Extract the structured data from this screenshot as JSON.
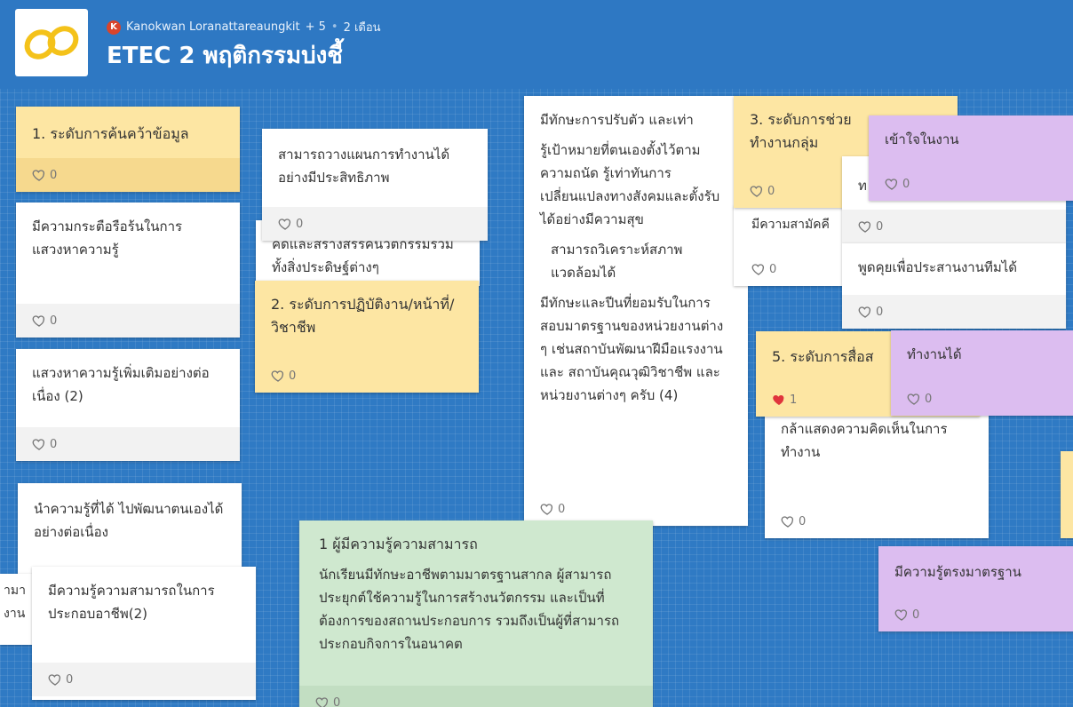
{
  "header": {
    "avatar_initial": "K",
    "author": "Kanokwan Loranattareaungkit",
    "contributors": "+ 5",
    "separator": "•",
    "time_ago": "2 เดือน",
    "title": "ETEC 2 พฤติกรรมบ่งชี้"
  },
  "colors": {
    "background": "#2f7ac4",
    "yellow_card": "#fde6a3",
    "green_card": "#cfe8cf",
    "purple_card": "#dcbdf0",
    "heart_liked": "#e0343c"
  },
  "posts": {
    "level1": {
      "text": "1. ระดับการค้นคว้าข้อมูล",
      "likes": "0"
    },
    "eager": {
      "text": "มีความกระตือรือร้นในการแสวงหาความรู้",
      "likes": "0"
    },
    "seek": {
      "text": "แสวงหาความรู้เพิ่มเติมอย่างต่อเนื่อง (2)",
      "likes": "0"
    },
    "apply_knowledge": {
      "text": "นำความรู้ที่ได้ ไปพัฒนาตนเองได้อย่างต่อเนื่อง"
    },
    "partial_left": {
      "line1": "ามา",
      "line2": "งาน"
    },
    "occupation": {
      "text": "มีความรู้ความสามารถในการประกอบอาชีพ(2)",
      "likes": "0"
    },
    "plan": {
      "text": "สามารถวางแผนการทำงานได้อย่างมีประสิทธิภาพ",
      "likes": "0"
    },
    "creative": {
      "text": "คิดและสร้างสรรค์นวัตกรรมรวมทั้งสิ่งประดิษฐ์ต่างๆ"
    },
    "level2": {
      "text": "2. ระดับการปฏิบัติงาน/หน้าที่/วิชาชีพ",
      "likes": "0"
    },
    "adapt": {
      "p1": "มีทักษะการปรับตัว และเท่า",
      "p2": "รู้เป้าหมายที่ตนเองตั้งไว้ตามความถนัด รู้เท่าทันการเปลี่ยนแปลงทางสังคมและตั้งรับได้อย่างมีความสุข",
      "p3": "สามารถวิเคราะห์สภาพแวดล้อมได้",
      "p4": "มีทักษะและปีนที่ยอมรับในการสอบมาตรฐานของหน่วยงานต่าง ๆ เช่นสถาบันพัฒนาฝีมือแรงงาน และ สถาบันคุณวุฒิวิชาชีพ และหน่วยงานต่างๆ ครับ (4)",
      "likes": "0"
    },
    "level3": {
      "line1": "3. ระดับการช่วย",
      "line2": "ทำงานกลุ่ม",
      "likes": "0"
    },
    "volunteer": {
      "text": "มีความสามัคคี",
      "likes": "0"
    },
    "partial_t": {
      "text": "ท",
      "likes": "0"
    },
    "understand": {
      "text": "เข้าใจในงาน",
      "likes": "0"
    },
    "teamwork": {
      "text": "พูดคุยเพื่อประสานงานทีมได้",
      "likes": "0"
    },
    "level5": {
      "text": "5. ระดับการสื่อส",
      "likes": "1"
    },
    "can_work": {
      "text": "ทำงานได้",
      "likes": "0"
    },
    "opinion": {
      "text": "กล้าแสดงความคิดเห็นในการทำงาน",
      "likes": "0"
    },
    "knowledgeable": {
      "title": "1 ผู้มีความรู้ความสามารถ",
      "text": "นักเรียนมีทักษะอาชีพตามมาตรฐานสากล ผู้สามารถประยุกต์ใช้ความรู้ในการสร้างนวัตกรรม และเป็นที่ต้องการของสถานประกอบการ รวมถึงเป็นผู้ที่สามารถประกอบกิจการในอนาคต",
      "likes": "0"
    },
    "standard": {
      "text": "มีความรู้ตรงมาตรฐาน",
      "likes": "0"
    }
  }
}
